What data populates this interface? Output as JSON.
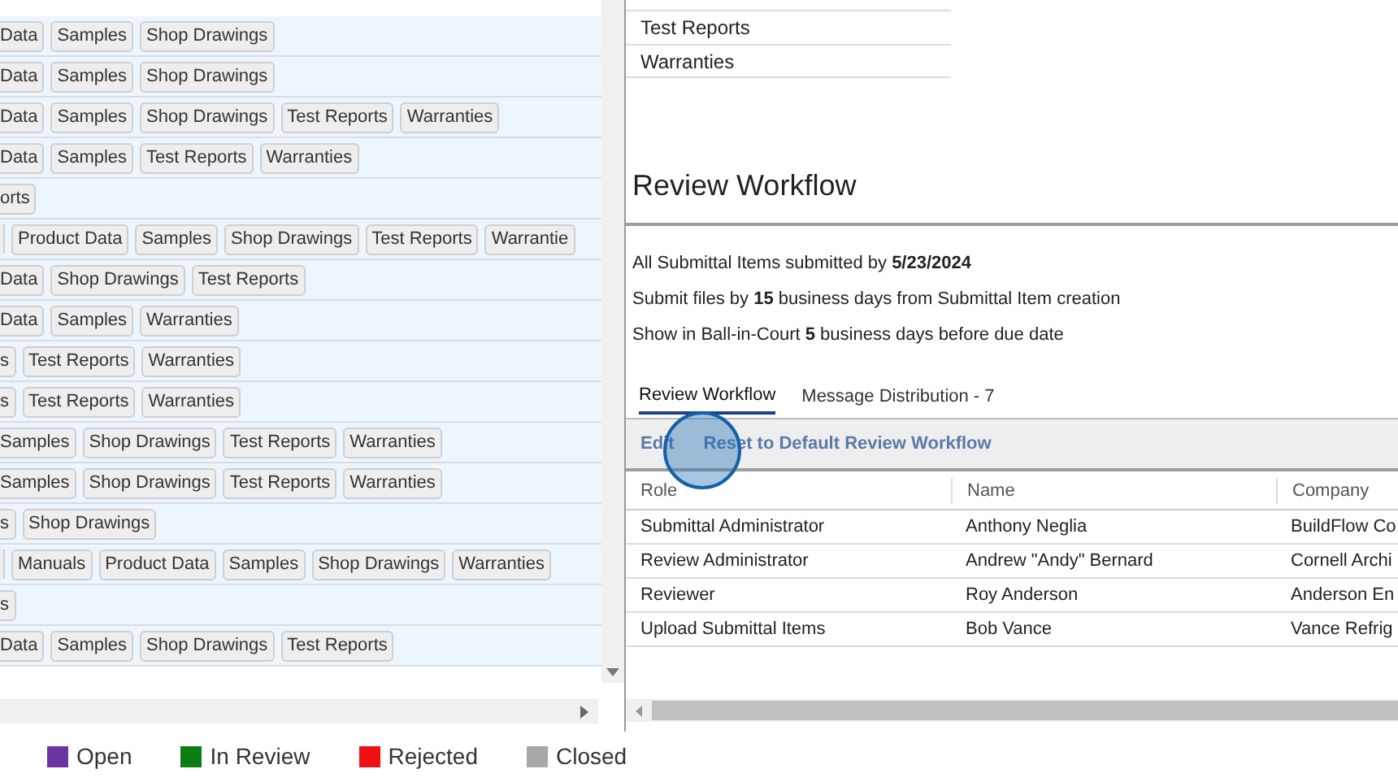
{
  "tag_rows": [
    {
      "cut": true,
      "tags": [
        "Data",
        "Samples",
        "Shop Drawings"
      ]
    },
    {
      "cut": true,
      "tags": [
        "Data",
        "Samples",
        "Shop Drawings"
      ]
    },
    {
      "cut": true,
      "tags": [
        "Data",
        "Samples",
        "Shop Drawings",
        "Test Reports",
        "Warranties"
      ]
    },
    {
      "cut": true,
      "tags": [
        "Data",
        "Samples",
        "Test Reports",
        "Warranties"
      ]
    },
    {
      "cut": true,
      "tags": [
        "orts"
      ]
    },
    {
      "cut": false,
      "tags": [
        "Product Data",
        "Samples",
        "Shop Drawings",
        "Test Reports",
        "Warrantie"
      ]
    },
    {
      "cut": true,
      "tags": [
        "Data",
        "Shop Drawings",
        "Test Reports"
      ]
    },
    {
      "cut": true,
      "tags": [
        "Data",
        "Samples",
        "Warranties"
      ]
    },
    {
      "cut": true,
      "tags": [
        "s",
        "Test Reports",
        "Warranties"
      ]
    },
    {
      "cut": true,
      "tags": [
        "s",
        "Test Reports",
        "Warranties"
      ]
    },
    {
      "cut": true,
      "tags": [
        "Samples",
        "Shop Drawings",
        "Test Reports",
        "Warranties"
      ]
    },
    {
      "cut": true,
      "tags": [
        "Samples",
        "Shop Drawings",
        "Test Reports",
        "Warranties"
      ]
    },
    {
      "cut": true,
      "tags": [
        "s",
        "Shop Drawings"
      ]
    },
    {
      "cut": false,
      "tags": [
        "Manuals",
        "Product Data",
        "Samples",
        "Shop Drawings",
        "Warranties"
      ]
    },
    {
      "cut": true,
      "tags": [
        "s"
      ]
    },
    {
      "cut": true,
      "tags": [
        "Data",
        "Samples",
        "Shop Drawings",
        "Test Reports"
      ]
    }
  ],
  "legend": [
    {
      "label": "Open",
      "color": "#6a35a0"
    },
    {
      "label": "In Review",
      "color": "#0b7d12"
    },
    {
      "label": "Rejected",
      "color": "#ee1111"
    },
    {
      "label": "Closed",
      "color": "#a8a8a8"
    }
  ],
  "type_list": [
    "Test Reports",
    "Warranties"
  ],
  "section_title": "Review Workflow",
  "rules": [
    "All Submittal Items submitted by **5/23/2024**",
    "Submit files by **15** business days from Submittal Item creation",
    "Show in Ball-in-Court **5** business days before due date"
  ],
  "tabs": [
    {
      "label": "Review Workflow",
      "selected": true
    },
    {
      "label": "Message Distribution - 7",
      "selected": false
    }
  ],
  "actions": [
    "Edit",
    "Reset to Default Review Workflow"
  ],
  "table": {
    "columns": [
      "Role",
      "Name",
      "Company"
    ],
    "rows": [
      [
        "Submittal Administrator",
        "Anthony Neglia",
        "BuildFlow Co"
      ],
      [
        "Review Administrator",
        "Andrew \"Andy\" Bernard",
        "Cornell Archi"
      ],
      [
        "Reviewer",
        "Roy Anderson",
        "Anderson En"
      ],
      [
        "Upload Submittal Items",
        "Bob Vance",
        "Vance Refrig"
      ]
    ]
  }
}
